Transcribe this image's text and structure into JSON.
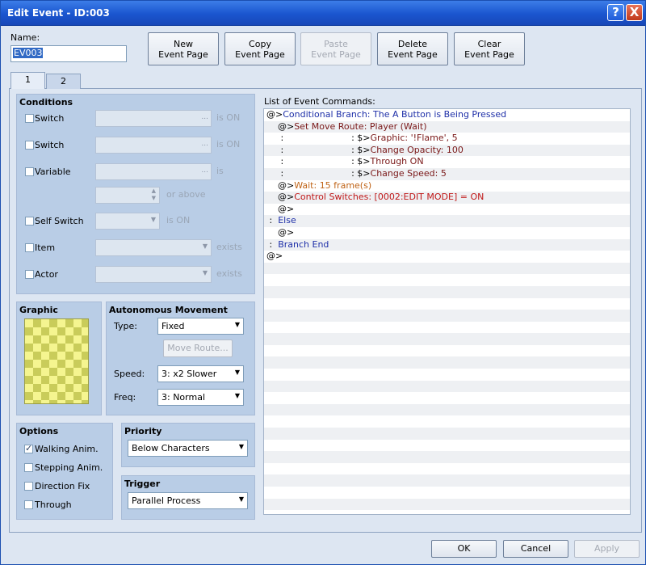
{
  "window": {
    "title": "Edit Event - ID:003",
    "help_icon": "?",
    "close_icon": "X"
  },
  "name": {
    "label": "Name:",
    "value": "EV003"
  },
  "top_buttons": [
    {
      "line1": "New",
      "line2": "Event Page",
      "enabled": true
    },
    {
      "line1": "Copy",
      "line2": "Event Page",
      "enabled": true
    },
    {
      "line1": "Paste",
      "line2": "Event Page",
      "enabled": false
    },
    {
      "line1": "Delete",
      "line2": "Event Page",
      "enabled": true
    },
    {
      "line1": "Clear",
      "line2": "Event Page",
      "enabled": true
    }
  ],
  "tabs": [
    {
      "label": "1",
      "selected": true
    },
    {
      "label": "2",
      "selected": false
    }
  ],
  "conditions": {
    "title": "Conditions",
    "switch1": {
      "label": "Switch",
      "suffix": "is ON",
      "dots": "..."
    },
    "switch2": {
      "label": "Switch",
      "suffix": "is ON",
      "dots": "..."
    },
    "variable": {
      "label": "Variable",
      "suffix": "is",
      "dots": "...",
      "spin_suffix": "or above"
    },
    "self_switch": {
      "label": "Self Switch",
      "suffix": "is ON"
    },
    "item": {
      "label": "Item",
      "suffix": "exists"
    },
    "actor": {
      "label": "Actor",
      "suffix": "exists"
    }
  },
  "graphic": {
    "title": "Graphic"
  },
  "autonomous": {
    "title": "Autonomous Movement",
    "type_label": "Type:",
    "type_value": "Fixed",
    "move_route_label": "Move Route...",
    "speed_label": "Speed:",
    "speed_value": "3: x2 Slower",
    "freq_label": "Freq:",
    "freq_value": "3: Normal"
  },
  "options": {
    "title": "Options",
    "items": [
      {
        "label": "Walking Anim.",
        "checked": true
      },
      {
        "label": "Stepping Anim.",
        "checked": false
      },
      {
        "label": "Direction Fix",
        "checked": false
      },
      {
        "label": "Through",
        "checked": false
      }
    ]
  },
  "priority": {
    "title": "Priority",
    "value": "Below Characters"
  },
  "trigger": {
    "title": "Trigger",
    "value": "Parallel Process"
  },
  "commands": {
    "label": "List of Event Commands:",
    "rows": [
      {
        "prefix": "@>",
        "text": "Conditional Branch: The A Button is Being Pressed",
        "color": "blue",
        "indent": 0
      },
      {
        "prefix": "    @>",
        "text": "Set Move Route: Player (Wait)",
        "color": "dark",
        "indent": 1
      },
      {
        "prefix": "     :                        : $>",
        "text": "Graphic: '!Flame', 5",
        "color": "dark",
        "indent": 1
      },
      {
        "prefix": "     :                        : $>",
        "text": "Change Opacity: 100",
        "color": "dark",
        "indent": 1
      },
      {
        "prefix": "     :                        : $>",
        "text": "Through ON",
        "color": "dark",
        "indent": 1
      },
      {
        "prefix": "     :                        : $>",
        "text": "Change Speed: 5",
        "color": "dark",
        "indent": 1
      },
      {
        "prefix": "    @>",
        "text": "Wait: 15 frame(s)",
        "color": "orange",
        "indent": 1
      },
      {
        "prefix": "    @>",
        "text": "Control Switches: [0002:EDIT MODE] = ON",
        "color": "red",
        "indent": 1
      },
      {
        "prefix": "    @>",
        "text": "",
        "color": "blk",
        "indent": 1
      },
      {
        "prefix": " :  ",
        "text": "Else",
        "color": "blue",
        "indent": 0
      },
      {
        "prefix": "    @>",
        "text": "",
        "color": "blk",
        "indent": 1
      },
      {
        "prefix": " :  ",
        "text": "Branch End",
        "color": "blue",
        "indent": 0
      },
      {
        "prefix": "@>",
        "text": "",
        "color": "blk",
        "indent": 0
      }
    ]
  },
  "bottom": {
    "ok": "OK",
    "cancel": "Cancel",
    "apply": "Apply"
  }
}
